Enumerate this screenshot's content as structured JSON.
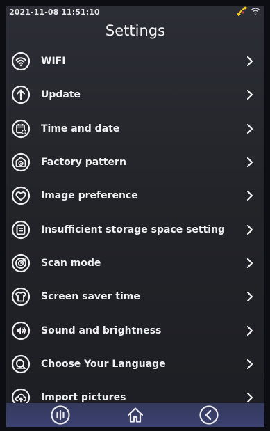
{
  "statusbar": {
    "datetime": "2021-11-08 11:51:10",
    "icons": [
      "usb-connection-icon",
      "wifi-icon"
    ]
  },
  "header": {
    "title": "Settings"
  },
  "menu": {
    "items": [
      {
        "label": "WIFI",
        "icon": "wifi-icon"
      },
      {
        "label": "Update",
        "icon": "arrow-up-icon"
      },
      {
        "label": "Time and date",
        "icon": "calendar-icon"
      },
      {
        "label": "Factory pattern",
        "icon": "factory-gear-icon"
      },
      {
        "label": "Image preference",
        "icon": "heart-icon"
      },
      {
        "label": "Insufficient storage space setting",
        "icon": "storage-icon"
      },
      {
        "label": "Scan mode",
        "icon": "target-icon"
      },
      {
        "label": "Screen saver time",
        "icon": "shirt-icon"
      },
      {
        "label": "Sound and brightness",
        "icon": "sound-brightness-icon"
      },
      {
        "label": "Choose Your Language",
        "icon": "language-icon"
      },
      {
        "label": "Import pictures",
        "icon": "cloud-upload-icon"
      }
    ],
    "chevron": "chevron-right-icon"
  },
  "bottom_nav": {
    "buttons": [
      "equalizer-icon",
      "home-icon",
      "back-icon"
    ]
  },
  "colors": {
    "screen_bg": "#232429",
    "text": "#f1f1f3",
    "bottom_bar": "#3a3f6a",
    "usb_icon": "#f2c624"
  }
}
